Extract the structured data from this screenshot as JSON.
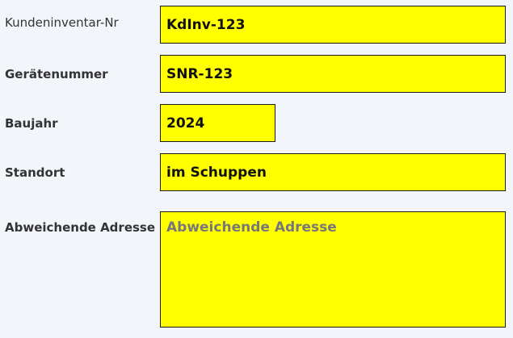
{
  "form": {
    "kundeninventar": {
      "label": "Kundeninventar-Nr",
      "value": "KdInv-123"
    },
    "geraetenummer": {
      "label": "Gerätenummer",
      "value": "SNR-123"
    },
    "baujahr": {
      "label": "Baujahr",
      "value": "2024"
    },
    "standort": {
      "label": "Standort",
      "value": "im Schuppen"
    },
    "abweichende_adresse": {
      "label": "Abweichende Adresse",
      "value": "",
      "placeholder": "Abweichende Adresse"
    }
  },
  "colors": {
    "field_background": "#ffff00",
    "page_background": "#f2f5f9",
    "label_text": "#333333"
  }
}
